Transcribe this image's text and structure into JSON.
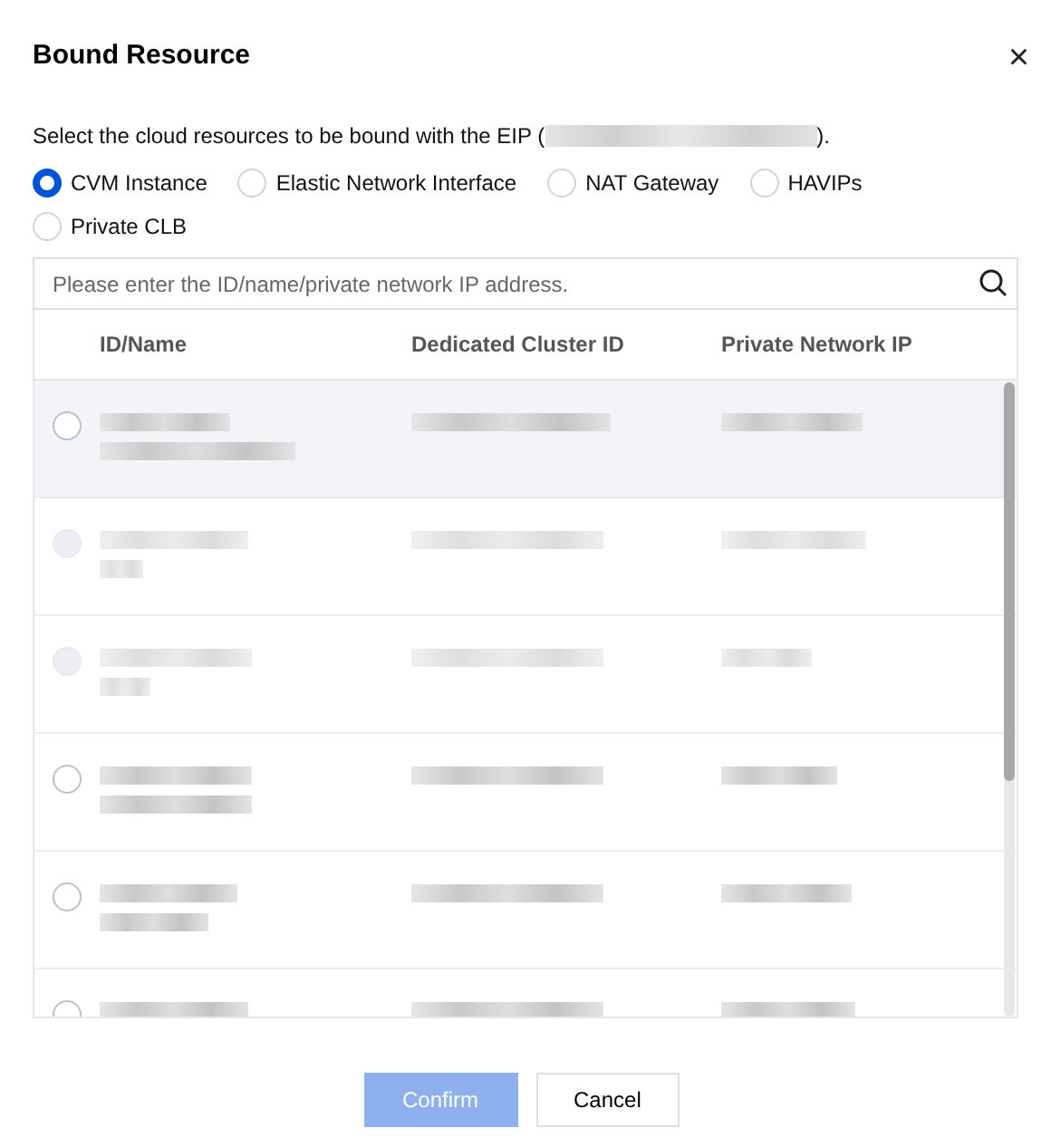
{
  "dialog": {
    "title": "Bound Resource",
    "close": "×"
  },
  "intro": {
    "before": "Select the cloud resources to be bound with the EIP (",
    "after": ")."
  },
  "resource_types": [
    {
      "label": "CVM Instance",
      "selected": true
    },
    {
      "label": "Elastic Network Interface",
      "selected": false
    },
    {
      "label": "NAT Gateway",
      "selected": false
    },
    {
      "label": "HAVIPs",
      "selected": false
    },
    {
      "label": "Private CLB",
      "selected": false
    }
  ],
  "search": {
    "placeholder": "Please enter the ID/name/private network IP address."
  },
  "table": {
    "columns": [
      "ID/Name",
      "Dedicated Cluster ID",
      "Private Network IP"
    ],
    "rows": [
      {
        "disabled": false,
        "highlighted": true
      },
      {
        "disabled": true,
        "highlighted": false
      },
      {
        "disabled": true,
        "highlighted": false
      },
      {
        "disabled": false,
        "highlighted": false
      },
      {
        "disabled": false,
        "highlighted": false
      },
      {
        "disabled": false,
        "highlighted": false
      }
    ]
  },
  "buttons": [
    {
      "label": "Confirm",
      "disabled": true
    },
    {
      "label": "Cancel",
      "disabled": false
    }
  ]
}
